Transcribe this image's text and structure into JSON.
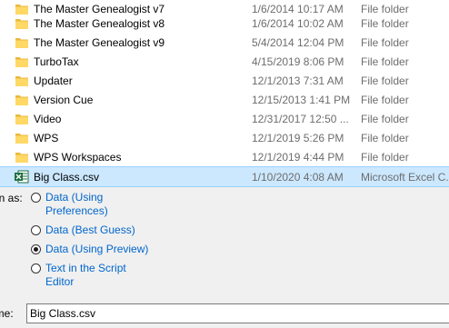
{
  "files": [
    {
      "name": "The Master Genealogist v7",
      "date": "1/6/2014 10:17 AM",
      "type": "File folder",
      "icon": "folder-icon"
    },
    {
      "name": "The Master Genealogist v8",
      "date": "1/6/2014 10:02 AM",
      "type": "File folder",
      "icon": "folder-icon"
    },
    {
      "name": "The Master Genealogist v9",
      "date": "5/4/2014 12:04 PM",
      "type": "File folder",
      "icon": "folder-icon"
    },
    {
      "name": "TurboTax",
      "date": "4/15/2019 8:06 PM",
      "type": "File folder",
      "icon": "folder-icon"
    },
    {
      "name": "Updater",
      "date": "12/1/2013 7:31 AM",
      "type": "File folder",
      "icon": "folder-icon"
    },
    {
      "name": "Version Cue",
      "date": "12/15/2013 1:41 PM",
      "type": "File folder",
      "icon": "folder-icon"
    },
    {
      "name": "Video",
      "date": "12/31/2017 12:50 ...",
      "type": "File folder",
      "icon": "folder-icon"
    },
    {
      "name": "WPS",
      "date": "12/1/2019 5:26 PM",
      "type": "File folder",
      "icon": "folder-icon"
    },
    {
      "name": "WPS Workspaces",
      "date": "12/1/2019 4:44 PM",
      "type": "File folder",
      "icon": "folder-icon"
    },
    {
      "name": "Big Class.csv",
      "date": "1/10/2020 4:08 AM",
      "type": "Microsoft Excel C...",
      "icon": "excel-csv-icon",
      "selected": true
    }
  ],
  "open_as": {
    "label": "en as:",
    "options": [
      {
        "line1": "Data (Using",
        "line2": "Preferences)",
        "checked": false
      },
      {
        "line1": "Data (Best Guess)",
        "line2": "",
        "checked": false
      },
      {
        "line1": "Data (Using Preview)",
        "line2": "",
        "checked": true
      },
      {
        "line1": "Text in the Script",
        "line2": "Editor",
        "checked": false
      }
    ]
  },
  "file_name": {
    "label": "ame:",
    "value": "Big Class.csv"
  },
  "colors": {
    "selection": "#cce8ff",
    "folder": "#ffd866",
    "link": "#0066cc",
    "excel": "#1d6f42"
  }
}
